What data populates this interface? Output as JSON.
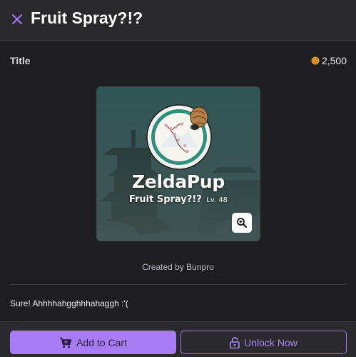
{
  "header": {
    "title": "Fruit Spray?!?"
  },
  "item": {
    "title_label": "Title",
    "price": "2,500",
    "card": {
      "username": "ZeldaPup",
      "title": "Fruit Spray?!?",
      "level": "Lv. 48"
    },
    "created_by": "Created by Bunpro",
    "description": "Sure! Ahhhhahgghhhahaggh :'("
  },
  "actions": {
    "add_to_cart": "Add to Cart",
    "unlock_now": "Unlock Now"
  },
  "colors": {
    "accent": "#a87cf5",
    "background": "#1e1e20",
    "coin": "#e8a23a"
  }
}
